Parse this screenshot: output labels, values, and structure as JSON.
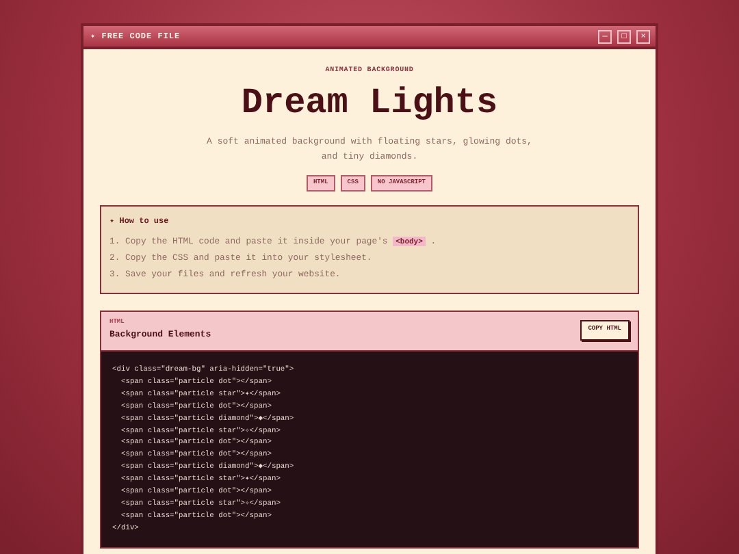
{
  "window": {
    "title": "✦ FREE CODE FILE",
    "controls": [
      "—",
      "□",
      "×"
    ]
  },
  "header": {
    "eyebrow": "ANIMATED BACKGROUND",
    "title": "Dream Lights",
    "subtitle": [
      "A soft animated background with floating stars, glowing dots,",
      "and tiny diamonds."
    ],
    "tags": [
      "HTML",
      "CSS",
      "NO JAVASCRIPT"
    ]
  },
  "how_to": {
    "heading": "✦ How to use",
    "steps": [
      {
        "number": "1.",
        "text": "Copy the HTML code and paste it inside your page's",
        "code": "<body>",
        "after": "."
      },
      {
        "number": "2.",
        "text": "Copy the CSS and paste it into your stylesheet."
      },
      {
        "number": "3.",
        "text": "Save your files and refresh your website."
      }
    ]
  },
  "code_card": {
    "label": "HTML",
    "title": "Background Elements",
    "button": "COPY HTML",
    "lines": [
      "<div class=\"dream-bg\" aria-hidden=\"true\">",
      "  <span class=\"particle dot\"></span>",
      "  <span class=\"particle star\">✦</span>",
      "  <span class=\"particle dot\"></span>",
      "  <span class=\"particle diamond\">◆</span>",
      "  <span class=\"particle star\">✧</span>",
      "  <span class=\"particle dot\"></span>",
      "  <span class=\"particle dot\"></span>",
      "  <span class=\"particle diamond\">◆</span>",
      "  <span class=\"particle star\">✦</span>",
      "  <span class=\"particle dot\"></span>",
      "  <span class=\"particle star\">✧</span>",
      "  <span class=\"particle dot\"></span>",
      "</div>"
    ]
  }
}
